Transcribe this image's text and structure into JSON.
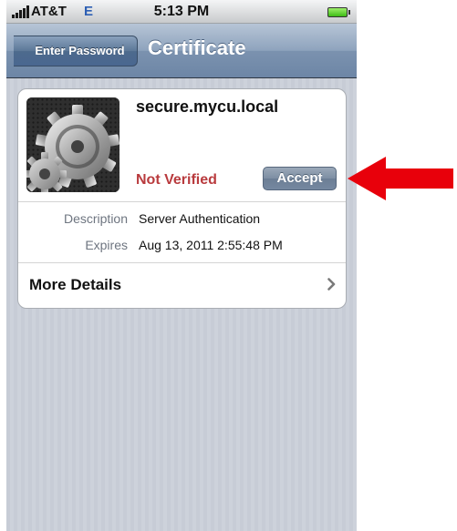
{
  "status_bar": {
    "carrier": "AT&T",
    "network": "E",
    "time": "5:13 PM",
    "battery_level": "full"
  },
  "nav_bar": {
    "back_label": "Enter Password",
    "title": "Certificate"
  },
  "certificate": {
    "name": "secure.mycu.local",
    "status": "Not Verified",
    "accept_label": "Accept",
    "details": [
      {
        "label": "Description",
        "value": "Server Authentication"
      },
      {
        "label": "Expires",
        "value": "Aug 13, 2011 2:55:48 PM"
      }
    ],
    "more_details_label": "More Details",
    "icon": "gears-icon"
  },
  "annotation": {
    "icon": "red-arrow-icon",
    "color": "#e8000b"
  },
  "colors": {
    "nav_bar": "#6d86a6",
    "not_verified": "#b93b3e",
    "background_stripes": "#c7ccd6"
  }
}
